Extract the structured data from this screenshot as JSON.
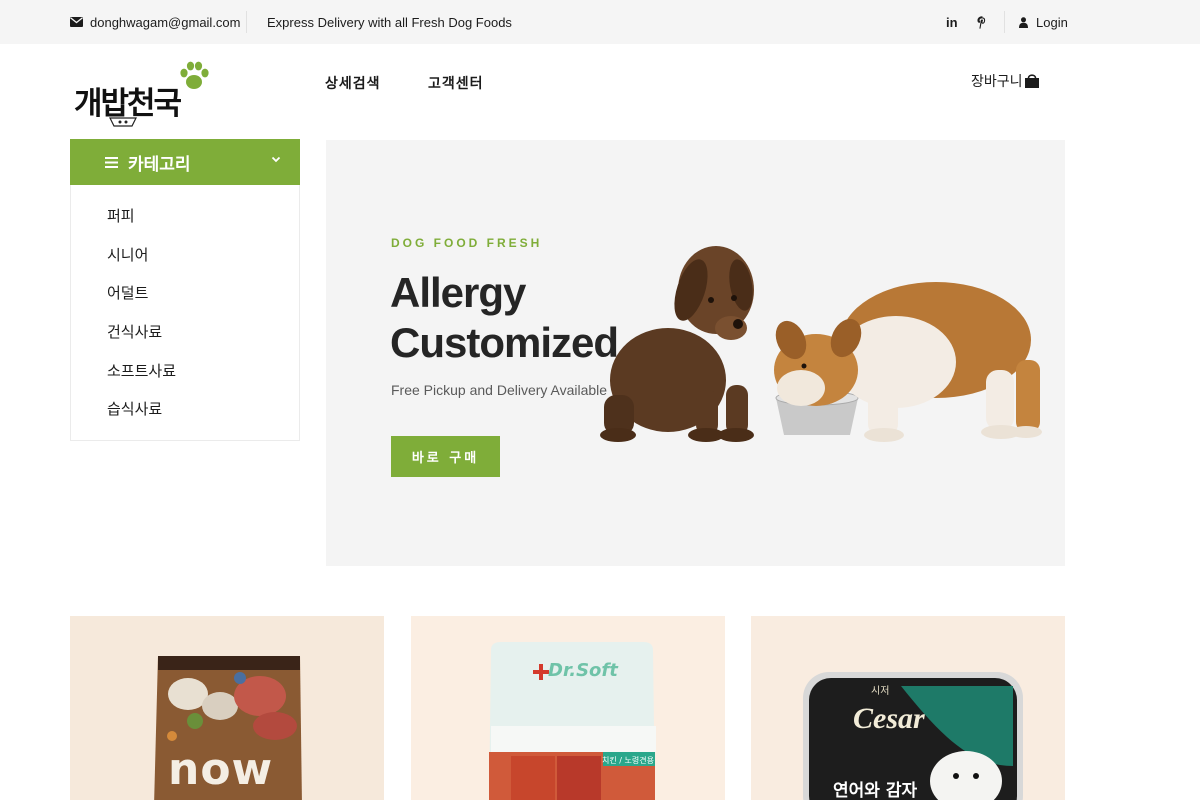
{
  "topbar": {
    "email": "donghwagam@gmail.com",
    "promo": "Express Delivery with all Fresh Dog Foods",
    "linkedin": "in",
    "login": "Login"
  },
  "header": {
    "logo": "개밥천국",
    "nav": [
      "상세검색",
      "고객센터"
    ],
    "cart": "장바구니"
  },
  "categories": {
    "title": "카테고리",
    "items": [
      "퍼피",
      "시니어",
      "어덜트",
      "건식사료",
      "소프트사료",
      "습식사료"
    ]
  },
  "hero": {
    "eyebrow": "DOG FOOD FRESH",
    "title_line1": "Allergy",
    "title_line2": "Customized",
    "subtitle": "Free Pickup and Delivery Available",
    "button": "바로 구매"
  },
  "products": [
    {
      "pack_text": "now"
    },
    {
      "pack_text": "Dr.Soft",
      "tag": "치킨 / 노령견용"
    },
    {
      "pack_text": "Cesar",
      "korean_brand": "시저",
      "flavor": "연어와 감자"
    }
  ],
  "colors": {
    "accent": "#7fad39",
    "topbar_bg": "#f5f5f5",
    "hero_bg": "#f4f4f4"
  }
}
